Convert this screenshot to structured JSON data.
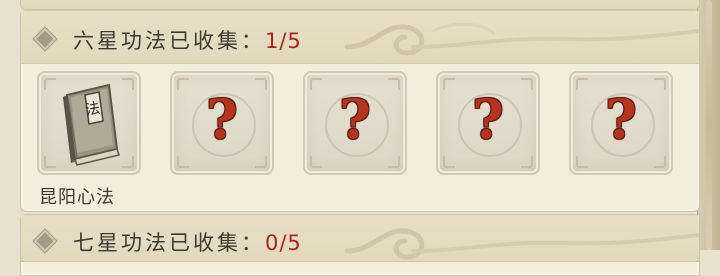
{
  "six_star": {
    "title": "六星功法已收集：",
    "count": "1/5",
    "slots": [
      {
        "state": "collected",
        "label": "昆阳心法",
        "book_glyph": "法",
        "icon": "book-icon"
      },
      {
        "state": "unknown",
        "glyph": "?",
        "icon": "question-mark-icon"
      },
      {
        "state": "unknown",
        "glyph": "?",
        "icon": "question-mark-icon"
      },
      {
        "state": "unknown",
        "glyph": "?",
        "icon": "question-mark-icon"
      },
      {
        "state": "unknown",
        "glyph": "?",
        "icon": "question-mark-icon"
      }
    ]
  },
  "seven_star": {
    "title": "七星功法已收集：",
    "count": "0/5"
  },
  "colors": {
    "count_red": "#a8281a",
    "panel_bg": "#f3eddc",
    "header_bg": "#e4dac0",
    "question_red": "#b4341f"
  }
}
